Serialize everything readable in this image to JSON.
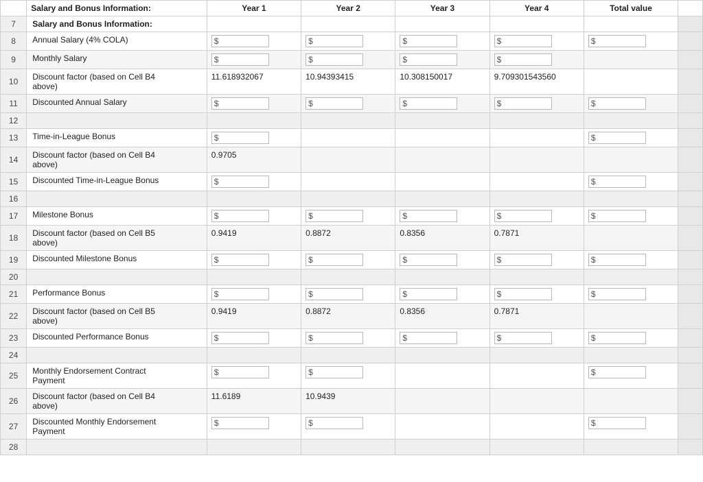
{
  "headers": {
    "row_num": "",
    "label": "Salary and Bonus Information:",
    "year1": "Year 1",
    "year2": "Year 2",
    "year3": "Year 3",
    "year4": "Year 4",
    "total": "Total value",
    "extra": ""
  },
  "rows": [
    {
      "num": "7",
      "label": "Salary and Bonus Information:",
      "label_bold": true,
      "year1": null,
      "year2": null,
      "year3": null,
      "year4": null,
      "total": null,
      "shaded": false,
      "empty": false,
      "is_header": true
    },
    {
      "num": "8",
      "label": "Annual Salary (4% COLA)",
      "year1": "$",
      "year2": "$",
      "year3": "$",
      "year4": "$",
      "total": "$",
      "year1_input": true,
      "year2_input": true,
      "year3_input": true,
      "year4_input": true,
      "total_input": true,
      "shaded": false,
      "empty": false
    },
    {
      "num": "9",
      "label": "Monthly Salary",
      "year1": "$",
      "year2": "$",
      "year3": "$",
      "year4": "$",
      "total": null,
      "year1_input": true,
      "year2_input": true,
      "year3_input": true,
      "year4_input": true,
      "total_input": false,
      "shaded": true,
      "empty": false
    },
    {
      "num": "10",
      "label": "Discount factor (based on Cell B4\nabove)",
      "year1": "11.618932067",
      "year2": "10.94393415",
      "year3": "10.308150017",
      "year4": "9.709301543560",
      "total": null,
      "year1_input": false,
      "year2_input": false,
      "year3_input": false,
      "year4_input": false,
      "total_input": false,
      "shaded": false,
      "empty": false
    },
    {
      "num": "11",
      "label": "Discounted Annual Salary",
      "year1": "$",
      "year2": "$",
      "year3": "$",
      "year4": "$",
      "total": "$",
      "year1_input": true,
      "year2_input": true,
      "year3_input": true,
      "year4_input": true,
      "total_input": true,
      "shaded": true,
      "empty": false
    },
    {
      "num": "12",
      "label": "",
      "year1": null,
      "year2": null,
      "year3": null,
      "year4": null,
      "total": null,
      "shaded": true,
      "empty": true
    },
    {
      "num": "13",
      "label": "Time-in-League Bonus",
      "year1": "$",
      "year2": null,
      "year3": null,
      "year4": null,
      "total": "$",
      "year1_input": true,
      "year2_input": false,
      "year3_input": false,
      "year4_input": false,
      "total_input": true,
      "shaded": false,
      "empty": false
    },
    {
      "num": "14",
      "label": "Discount factor (based on Cell B4\nabove)",
      "year1": "0.9705",
      "year2": null,
      "year3": null,
      "year4": null,
      "total": null,
      "year1_input": false,
      "year2_input": false,
      "year3_input": false,
      "year4_input": false,
      "total_input": false,
      "shaded": true,
      "empty": false
    },
    {
      "num": "15",
      "label": "Discounted Time-in-League Bonus",
      "year1": "$",
      "year2": null,
      "year3": null,
      "year4": null,
      "total": "$",
      "year1_input": true,
      "year2_input": false,
      "year3_input": false,
      "year4_input": false,
      "total_input": true,
      "shaded": false,
      "empty": false
    },
    {
      "num": "16",
      "label": "",
      "year1": null,
      "year2": null,
      "year3": null,
      "year4": null,
      "total": null,
      "shaded": true,
      "empty": true
    },
    {
      "num": "17",
      "label": "Milestone Bonus",
      "year1": "$",
      "year2": "$",
      "year3": "$",
      "year4": "$",
      "total": "$",
      "year1_input": true,
      "year2_input": true,
      "year3_input": true,
      "year4_input": true,
      "total_input": true,
      "shaded": false,
      "empty": false
    },
    {
      "num": "18",
      "label": "Discount factor (based on Cell B5\nabove)",
      "year1": "0.9419",
      "year2": "0.8872",
      "year3": "0.8356",
      "year4": "0.7871",
      "total": null,
      "year1_input": false,
      "year2_input": false,
      "year3_input": false,
      "year4_input": false,
      "total_input": false,
      "shaded": true,
      "empty": false
    },
    {
      "num": "19",
      "label": "Discounted Milestone Bonus",
      "year1": "$",
      "year2": "$",
      "year3": "$",
      "year4": "$",
      "total": "$",
      "year1_input": true,
      "year2_input": true,
      "year3_input": true,
      "year4_input": true,
      "total_input": true,
      "shaded": false,
      "empty": false
    },
    {
      "num": "20",
      "label": "",
      "year1": null,
      "year2": null,
      "year3": null,
      "year4": null,
      "total": null,
      "shaded": true,
      "empty": true
    },
    {
      "num": "21",
      "label": "Performance Bonus",
      "year1": "$",
      "year2": "$",
      "year3": "$",
      "year4": "$",
      "total": "$",
      "year1_input": true,
      "year2_input": true,
      "year3_input": true,
      "year4_input": true,
      "total_input": true,
      "shaded": false,
      "empty": false
    },
    {
      "num": "22",
      "label": "Discount factor (based on Cell B5\nabove)",
      "year1": "0.9419",
      "year2": "0.8872",
      "year3": "0.8356",
      "year4": "0.7871",
      "total": null,
      "year1_input": false,
      "year2_input": false,
      "year3_input": false,
      "year4_input": false,
      "total_input": false,
      "shaded": true,
      "empty": false
    },
    {
      "num": "23",
      "label": "Discounted Performance Bonus",
      "year1": "$",
      "year2": "$",
      "year3": "$",
      "year4": "$",
      "total": "$",
      "year1_input": true,
      "year2_input": true,
      "year3_input": true,
      "year4_input": true,
      "total_input": true,
      "shaded": false,
      "empty": false
    },
    {
      "num": "24",
      "label": "",
      "year1": null,
      "year2": null,
      "year3": null,
      "year4": null,
      "total": null,
      "shaded": true,
      "empty": true
    },
    {
      "num": "25",
      "label": "Monthly Endorsement Contract\nPayment",
      "year1": "$",
      "year2": "$",
      "year3": null,
      "year4": null,
      "total": "$",
      "year1_input": true,
      "year2_input": true,
      "year3_input": false,
      "year4_input": false,
      "total_input": true,
      "shaded": false,
      "empty": false
    },
    {
      "num": "26",
      "label": "Discount factor (based on Cell B4\nabove)",
      "year1": "11.6189",
      "year2": "10.9439",
      "year3": null,
      "year4": null,
      "total": null,
      "year1_input": false,
      "year2_input": false,
      "year3_input": false,
      "year4_input": false,
      "total_input": false,
      "shaded": true,
      "empty": false
    },
    {
      "num": "27",
      "label": "Discounted Monthly Endorsement\nPayment",
      "year1": "$",
      "year2": "$",
      "year3": null,
      "year4": null,
      "total": "$",
      "year1_input": true,
      "year2_input": true,
      "year3_input": false,
      "year4_input": false,
      "total_input": true,
      "shaded": false,
      "empty": false
    },
    {
      "num": "28",
      "label": "",
      "year1": null,
      "year2": null,
      "year3": null,
      "year4": null,
      "total": null,
      "shaded": true,
      "empty": true
    }
  ]
}
